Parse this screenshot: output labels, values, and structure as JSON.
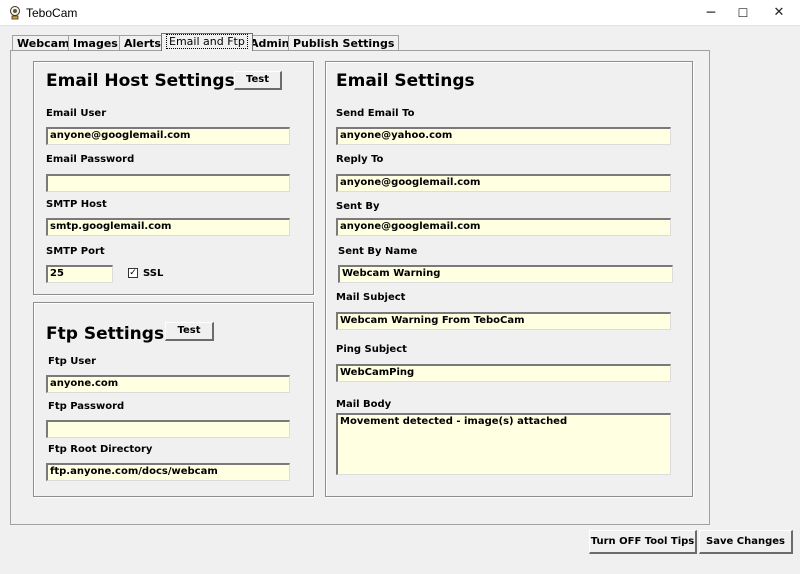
{
  "window": {
    "title": "TeboCam",
    "icon": "tebocam-app-icon",
    "minimize_glyph": "─",
    "maximize_glyph": "☐",
    "close_glyph": "✕"
  },
  "tabs": [
    {
      "label": "Webcam",
      "active": false
    },
    {
      "label": "Images",
      "active": false
    },
    {
      "label": "Alerts",
      "active": false
    },
    {
      "label": "Email and Ftp",
      "active": true
    },
    {
      "label": "Admin",
      "active": false
    },
    {
      "label": "Publish Settings",
      "active": false
    }
  ],
  "email_host": {
    "heading": "Email Host Settings",
    "test_label": "Test",
    "user_label": "Email User",
    "user_value": "anyone@googlemail.com",
    "password_label": "Email Password",
    "password_value": "",
    "smtp_host_label": "SMTP Host",
    "smtp_host_value": "smtp.googlemail.com",
    "smtp_port_label": "SMTP Port",
    "smtp_port_value": "25",
    "ssl_label": "SSL",
    "ssl_checked": true,
    "check_glyph": "✓"
  },
  "ftp": {
    "heading": "Ftp Settings",
    "test_label": "Test",
    "user_label": "Ftp User",
    "user_value": "anyone.com",
    "password_label": "Ftp Password",
    "password_value": "",
    "root_label": "Ftp Root Directory",
    "root_value": "ftp.anyone.com/docs/webcam"
  },
  "email_settings": {
    "heading": "Email Settings",
    "send_to_label": "Send Email To",
    "send_to_value": "anyone@yahoo.com",
    "reply_to_label": "Reply To",
    "reply_to_value": "anyone@googlemail.com",
    "sent_by_label": "Sent By",
    "sent_by_value": "anyone@googlemail.com",
    "sent_by_name_label": "Sent By Name",
    "sent_by_name_value": "Webcam Warning",
    "mail_subject_label": "Mail Subject",
    "mail_subject_value": "Webcam Warning From TeboCam",
    "ping_subject_label": "Ping Subject",
    "ping_subject_value": "WebCamPing",
    "mail_body_label": "Mail Body",
    "mail_body_value": "Movement detected - image(s) attached"
  },
  "footer": {
    "tooltips_label": "Turn OFF Tool Tips",
    "save_label": "Save Changes"
  },
  "colors": {
    "field_bg": "#ffffe1",
    "window_bg": "#f0f0f0"
  }
}
